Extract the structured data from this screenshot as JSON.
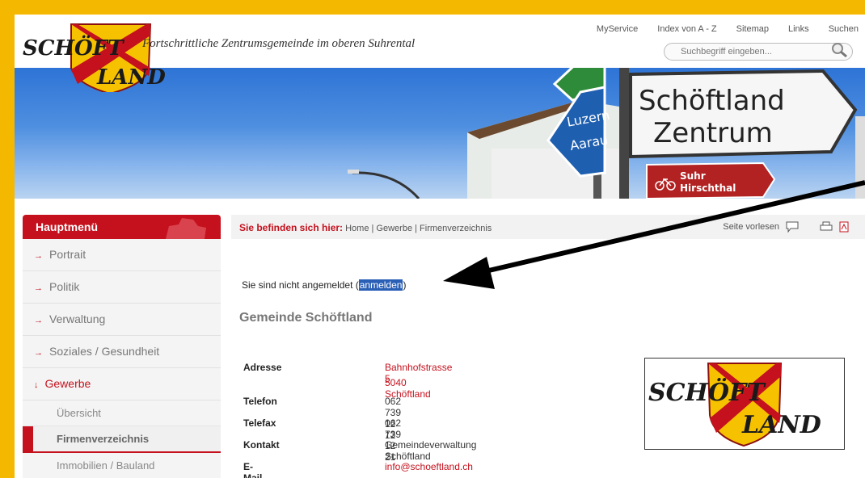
{
  "header": {
    "logo_top": "SCHÖFT",
    "logo_bottom": "LAND",
    "tagline": "Fortschrittliche Zentrumsgemeinde im oberen Suhrental",
    "topnav": [
      "MyService",
      "Index von A - Z",
      "Sitemap",
      "Links",
      "Suchen"
    ],
    "search_placeholder": "Suchbegriff eingeben..."
  },
  "banner": {
    "sign_main_line1": "Schöftland",
    "sign_main_line2": "Zentrum",
    "sign_blue_line1": "Luzern",
    "sign_blue_line2": "Aarau",
    "sign_red_line1": "Suhr",
    "sign_red_line2": "Hirschthal"
  },
  "sidebar": {
    "title": "Hauptmenü",
    "items": [
      "Portrait",
      "Politik",
      "Verwaltung",
      "Soziales / Gesundheit",
      "Gewerbe"
    ],
    "subitems": [
      "Übersicht",
      "Firmenverzeichnis",
      "Immobilien / Bauland"
    ]
  },
  "breadcrumb": {
    "label": "Sie befinden sich hier:",
    "path": [
      "Home",
      "Gewerbe",
      "Firmenverzeichnis"
    ],
    "read_aloud": "Seite vorlesen"
  },
  "notice": {
    "text": "Sie sind nicht angemeldet (",
    "link": "anmelden",
    "close": ")"
  },
  "main": {
    "title": "Gemeinde Schöftland",
    "rows": [
      {
        "key": "Adresse",
        "value": "Bahnhofstrasse 5",
        "value2": "5040 Schöftland"
      },
      {
        "key": "Telefon",
        "value": "062 739 12 12"
      },
      {
        "key": "Telefax",
        "value": "062 739 12 21"
      },
      {
        "key": "Kontakt",
        "value": "Gemeindeverwaltung Schöftland"
      },
      {
        "key": "E-Mail",
        "value": "info@schoeftland.ch"
      }
    ]
  },
  "colors": {
    "accent": "#c4111d",
    "frame": "#f5b800",
    "highlight": "#2a5fb6"
  }
}
